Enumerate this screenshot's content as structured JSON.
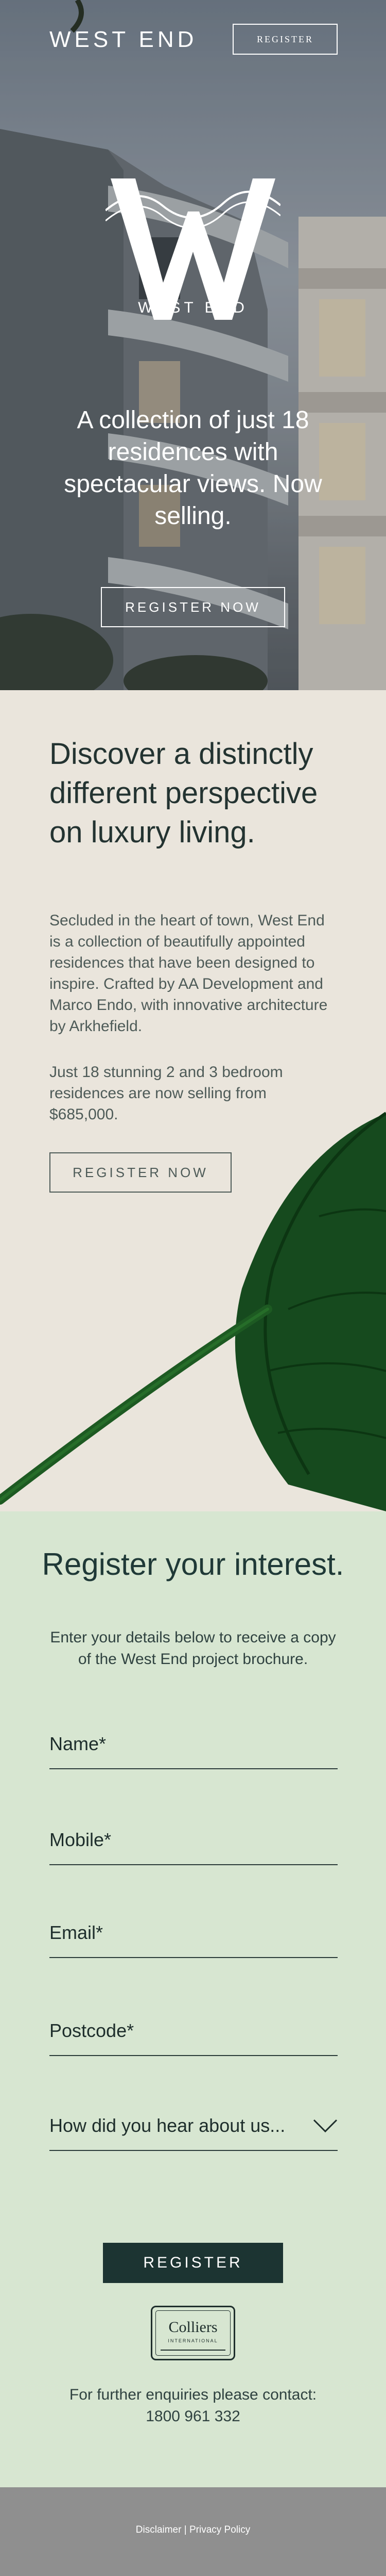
{
  "header": {
    "brand": "WEST END",
    "register_label": "REGISTER"
  },
  "hero": {
    "logo_word": "WEST END",
    "headline": "A collection of just 18 residences with spectacular views. Now selling.",
    "cta_label": "REGISTER NOW"
  },
  "intro": {
    "heading": "Discover a distinctly different perspective on luxury living.",
    "paragraph1": "Secluded in the heart of town, West End is a collection of beautifully appointed residences that have been designed to inspire. Crafted by AA Development and Marco Endo, with innovative architecture by Arkhefield.",
    "paragraph2": "Just 18 stunning 2 and 3 bedroom residences are now selling from $685,000.",
    "cta_label": "REGISTER NOW"
  },
  "form": {
    "heading": "Register your interest.",
    "lead": "Enter your details below to receive a copy of the West End project brochure.",
    "fields": {
      "name": "Name*",
      "mobile": "Mobile*",
      "email": "Email*",
      "postcode": "Postcode*"
    },
    "select_label": "How did you hear about us...",
    "submit_label": "REGISTER",
    "partner_logo": {
      "name": "Colliers",
      "sub": "INTERNATIONAL"
    },
    "contact": "For further enquiries please contact: 1800 961 332"
  },
  "footer": {
    "disclaimer": "Disclaimer",
    "separator": "|",
    "privacy": "Privacy Policy"
  },
  "colors": {
    "hero_overlay": "#7f8a94",
    "intro_bg": "#eae5dc",
    "form_bg": "#d7e6d1",
    "button_dark": "#1c3432",
    "footer_bg": "#8f8f8f"
  }
}
